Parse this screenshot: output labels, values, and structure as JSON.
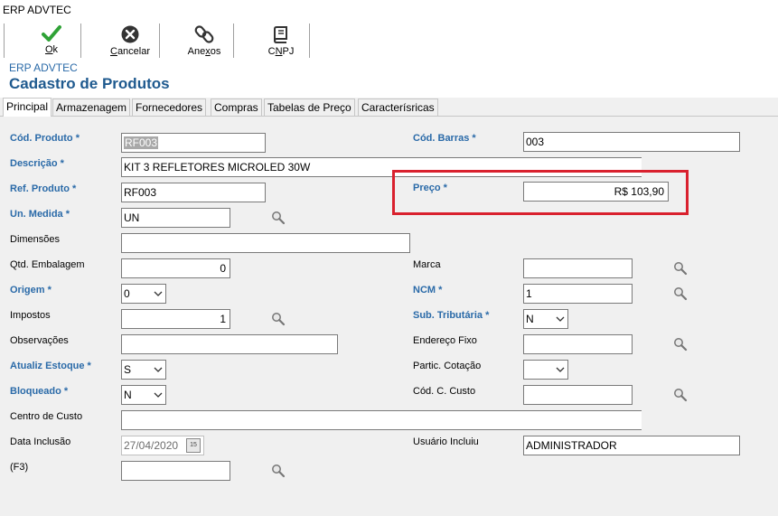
{
  "window": {
    "title": "ERP ADVTEC"
  },
  "toolbar": {
    "ok": {
      "label": "Ok",
      "mnemonic": "O",
      "rest": "k"
    },
    "cancel": {
      "label": "Cancelar",
      "mnemonic": "C",
      "rest": "ancelar"
    },
    "attachments": {
      "label": "Anexos",
      "mnemonic": "x",
      "pre": "Ane",
      "rest": "os"
    },
    "cnpj": {
      "label": "CNPJ",
      "mnemonic": "N",
      "pre": "C",
      "rest": "PJ"
    }
  },
  "header": {
    "app_name": "ERP ADVTEC",
    "title": "Cadastro de Produtos"
  },
  "tabs": [
    "Principal",
    "Armazenagem",
    "Fornecedores",
    "Compras",
    "Tabelas de Preço",
    "Caracterísricas"
  ],
  "form": {
    "cod_produto": {
      "label": "Cód. Produto *",
      "value": "RF003"
    },
    "cod_barras": {
      "label": "Cód. Barras *",
      "value": "003"
    },
    "descricao": {
      "label": "Descrição *",
      "value": "KIT 3 REFLETORES MICROLED 30W"
    },
    "ref_produto": {
      "label": "Ref. Produto *",
      "value": "RF003"
    },
    "preco": {
      "label": "Preço *",
      "value": "R$ 103,90"
    },
    "un_medida": {
      "label": "Un. Medida *",
      "value": "UN"
    },
    "dimensoes": {
      "label": "Dimensões",
      "value": ""
    },
    "qtd_embalagem": {
      "label": "Qtd. Embalagem",
      "value": "0"
    },
    "marca": {
      "label": "Marca",
      "value": ""
    },
    "origem": {
      "label": "Origem *",
      "value": "0"
    },
    "ncm": {
      "label": "NCM *",
      "value": "1"
    },
    "impostos": {
      "label": "Impostos",
      "value": "1"
    },
    "sub_tributaria": {
      "label": "Sub. Tributária *",
      "value": "N"
    },
    "observacoes": {
      "label": "Observações",
      "value": ""
    },
    "endereco_fixo": {
      "label": "Endereço Fixo",
      "value": ""
    },
    "atualiz_estoque": {
      "label": "Atualiz Estoque *",
      "value": "S"
    },
    "partic_cotacao": {
      "label": "Partic. Cotação",
      "value": ""
    },
    "bloqueado": {
      "label": "Bloqueado *",
      "value": "N"
    },
    "cod_c_custo": {
      "label": "Cód. C. Custo",
      "value": ""
    },
    "centro_custo": {
      "label": "Centro de Custo",
      "value": ""
    },
    "data_inclusao": {
      "label": "Data Inclusão",
      "value": "27/04/2020",
      "calendar_text": "15"
    },
    "usuario_incluiu": {
      "label": "Usuário Incluiu",
      "value": "ADMINISTRADOR"
    },
    "f3": {
      "label": "(F3)",
      "value": ""
    }
  },
  "colors": {
    "required_label": "#2a6aa8",
    "title": "#1f5a8f",
    "highlight": "#d9212e",
    "ok_check": "#2fa236"
  }
}
